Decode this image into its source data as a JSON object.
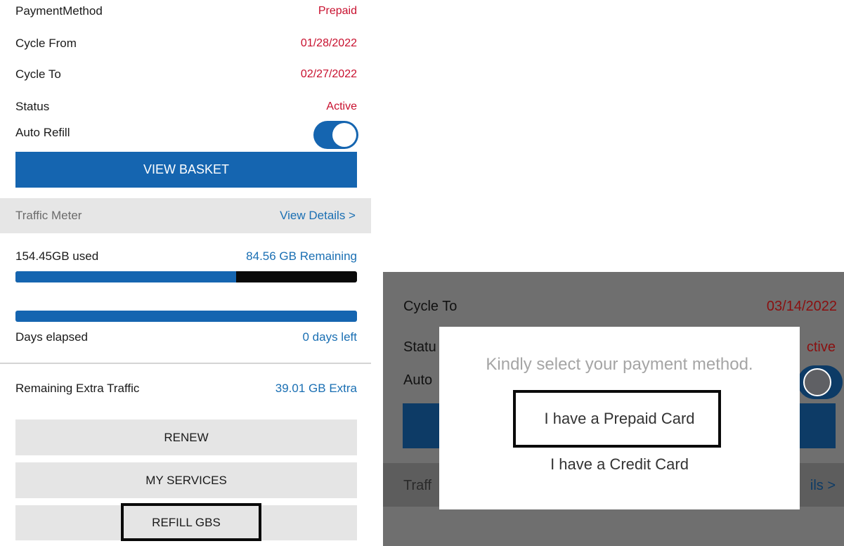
{
  "left_panel": {
    "rows": {
      "payment_method": {
        "label": "PaymentMethod",
        "value": "Prepaid"
      },
      "cycle_from": {
        "label": "Cycle From",
        "value": "01/28/2022"
      },
      "cycle_to": {
        "label": "Cycle To",
        "value": "02/27/2022"
      },
      "status": {
        "label": "Status",
        "value": "Active"
      },
      "auto_refill": {
        "label": "Auto Refill",
        "on": true
      }
    },
    "view_basket_label": "VIEW BASKET",
    "traffic_meter": {
      "title": "Traffic Meter",
      "link": "View Details >"
    },
    "usage": {
      "used": "154.45GB used",
      "remaining": "84.56 GB Remaining",
      "used_fraction": 0.646
    },
    "days": {
      "label": "Days elapsed",
      "value": "0 days left",
      "elapsed_fraction": 1.0
    },
    "extra": {
      "label": "Remaining Extra Traffic",
      "value": "39.01 GB Extra"
    },
    "buttons": {
      "renew": "RENEW",
      "my_services": "MY SERVICES",
      "refill": "REFILL GBS"
    }
  },
  "right_panel": {
    "background": {
      "cycle_to_label": "Cycle To",
      "cycle_to_value": "03/14/2022",
      "status_partial": "Statu",
      "status_value_partial": "ctive",
      "auto_partial": "Auto",
      "traffic_partial": "Traff",
      "details_partial": "ils >"
    },
    "dialog": {
      "message": "Kindly select your payment method.",
      "prepaid_option": "I have a Prepaid Card",
      "credit_option": "I have a Credit Card"
    }
  },
  "colors": {
    "primary": "#1565b0",
    "accent_red": "#c8102e",
    "link_blue": "#1a6fb3"
  }
}
